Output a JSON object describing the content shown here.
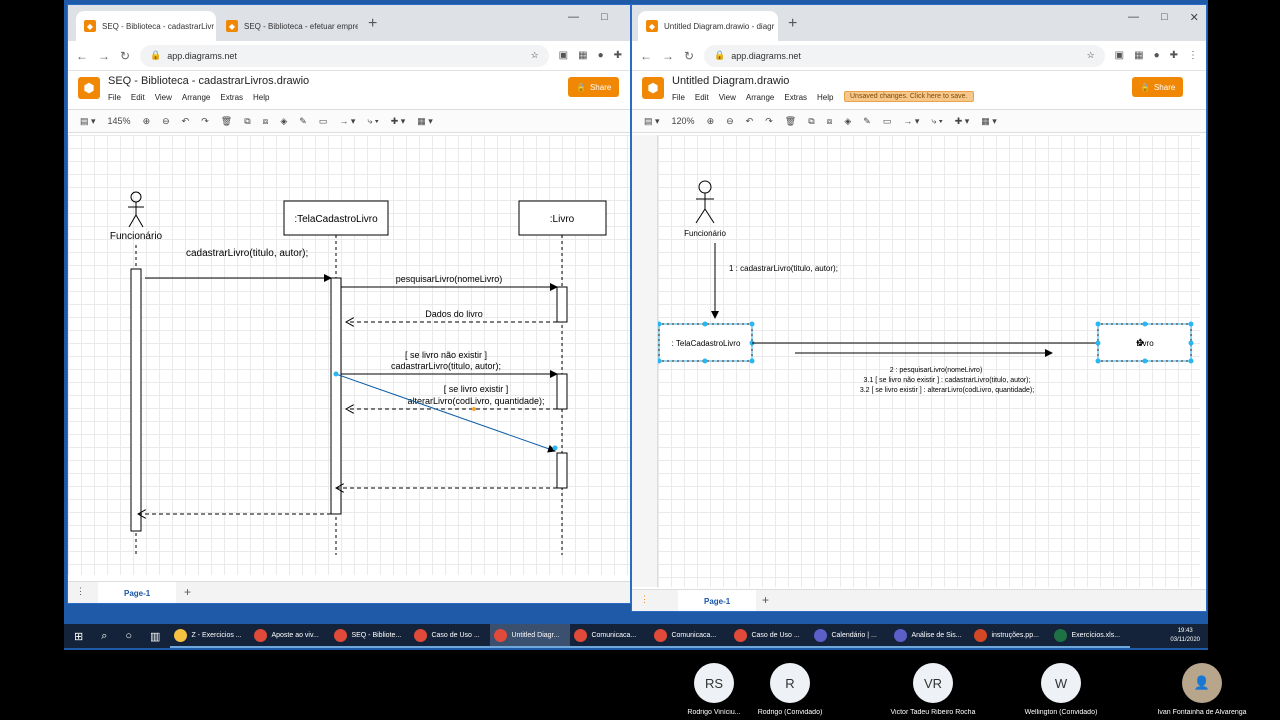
{
  "left_window": {
    "tabs": [
      {
        "label": "SEQ - Biblioteca - cadastrarLivr"
      },
      {
        "label": "SEQ - Biblioteca - efetuar empre"
      }
    ],
    "url": "app.diagrams.net",
    "title": "SEQ - Biblioteca - cadastrarLivros.drawio",
    "menu": [
      "File",
      "Edit",
      "View",
      "Arrange",
      "Extras",
      "Help"
    ],
    "share_label": "Share",
    "zoom": "145%",
    "page_tab": "Page-1",
    "diagram": {
      "actor": "Funcionário",
      "lifeline_tela": ":TelaCadastroLivro",
      "lifeline_livro": ":Livro",
      "msg1": "cadastrarLivro(titulo, autor);",
      "msg2": "pesquisarLivro(nomeLivro)",
      "msg3": "Dados do livro",
      "msg4_cond": "[ se livro não existir ]",
      "msg4": "cadastrarLivro(titulo, autor);",
      "msg5_cond": "[ se livro existir ]",
      "msg5": "alterarLivro(codLivro, quantidade);"
    }
  },
  "right_window": {
    "tabs": [
      {
        "label": "Untitled Diagram.drawio - diagr"
      }
    ],
    "url": "app.diagrams.net",
    "title": "Untitled Diagram.drawio",
    "menu": [
      "File",
      "Edit",
      "View",
      "Arrange",
      "Extras",
      "Help"
    ],
    "unsaved": "Unsaved changes. Click here to save.",
    "share_label": "Share",
    "zoom": "120%",
    "page_tab": "Page-1",
    "diagram": {
      "actor": "Funcionário",
      "msg1": "1 : cadastrarLivro(titulo, autor);",
      "box_tela": ": TelaCadastroLivro",
      "box_livro": "Livro",
      "msg2": "2 : pesquisarLivro(nomeLivro)",
      "msg3": "3.1  [ se livro não existir ] : cadastrarLivro(titulo, autor);",
      "msg4": "3.2 [ se livro existir ] : alterarLivro(codLivro, quantidade);"
    }
  },
  "taskbar": {
    "items": [
      {
        "label": "Z - Exercicios ...",
        "color": "#f5c242"
      },
      {
        "label": "Aposte ao viv...",
        "color": "#e04a3a"
      },
      {
        "label": "SEQ - Bibliote...",
        "color": "#e04a3a"
      },
      {
        "label": "Caso de Uso ...",
        "color": "#e04a3a"
      },
      {
        "label": "Untitled Diagr...",
        "color": "#e04a3a"
      },
      {
        "label": "Comunicaca...",
        "color": "#e04a3a"
      },
      {
        "label": "Comunicaca...",
        "color": "#e04a3a"
      },
      {
        "label": "Caso de Uso ...",
        "color": "#e04a3a"
      },
      {
        "label": "Calendário | ...",
        "color": "#5b5fc7"
      },
      {
        "label": "Análise de Sis...",
        "color": "#5b5fc7"
      },
      {
        "label": "instruções.pp...",
        "color": "#d24726"
      },
      {
        "label": "Exercícios.xls...",
        "color": "#1e7145"
      }
    ],
    "time": "19:43",
    "date": "03/11/2020"
  },
  "participants": [
    {
      "initials": "RS",
      "name": "Rodrigo Viníciu..."
    },
    {
      "initials": "R",
      "name": "Rodrigo (Convidado)"
    },
    {
      "initials": "VR",
      "name": "Victor Tadeu Ribeiro Rocha"
    },
    {
      "initials": "W",
      "name": "Wellington (Convidado)"
    },
    {
      "initials": "",
      "name": "Ivan Fontainha de Alvarenga"
    }
  ]
}
